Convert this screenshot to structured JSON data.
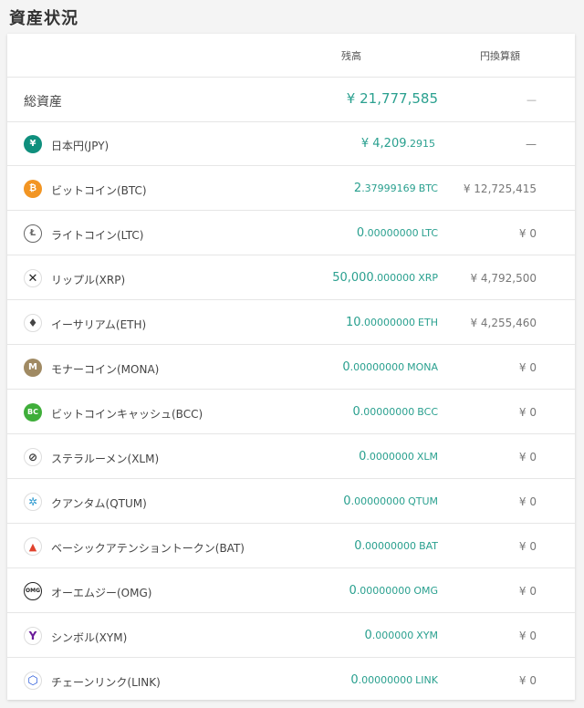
{
  "page_title": "資産状況",
  "table": {
    "headers": {
      "balance": "残高",
      "jpy": "円換算額"
    },
    "total": {
      "label": "総資産",
      "value": "¥ 21,777,585",
      "jpy": "—"
    },
    "rows": [
      {
        "name": "日本円(JPY)",
        "int": "¥ 4,209",
        "frac": ".2915",
        "unit": "",
        "jpy": "—",
        "icon": "yen-icon",
        "color": "#0f8f7d"
      },
      {
        "name": "ビットコイン(BTC)",
        "int": "2",
        "frac": ".37999169",
        "unit": "BTC",
        "jpy": "¥ 12,725,415",
        "icon": "bitcoin-icon",
        "color": "#f29523"
      },
      {
        "name": "ライトコイン(LTC)",
        "int": "0",
        "frac": ".00000000",
        "unit": "LTC",
        "jpy": "¥ 0",
        "icon": "litecoin-icon",
        "color": "#666666"
      },
      {
        "name": "リップル(XRP)",
        "int": "50,000",
        "frac": ".000000",
        "unit": "XRP",
        "jpy": "¥ 4,792,500",
        "icon": "ripple-icon",
        "color": "#222222"
      },
      {
        "name": "イーサリアム(ETH)",
        "int": "10",
        "frac": ".00000000",
        "unit": "ETH",
        "jpy": "¥ 4,255,460",
        "icon": "ethereum-icon",
        "color": "#444444"
      },
      {
        "name": "モナーコイン(MONA)",
        "int": "0",
        "frac": ".00000000",
        "unit": "MONA",
        "jpy": "¥ 0",
        "icon": "monacoin-icon",
        "color": "#a08a63"
      },
      {
        "name": "ビットコインキャッシュ(BCC)",
        "int": "0",
        "frac": ".00000000",
        "unit": "BCC",
        "jpy": "¥ 0",
        "icon": "bitcoin-cash-icon",
        "color": "#3fae3a"
      },
      {
        "name": "ステラルーメン(XLM)",
        "int": "0",
        "frac": ".0000000",
        "unit": "XLM",
        "jpy": "¥ 0",
        "icon": "stellar-icon",
        "color": "#333333"
      },
      {
        "name": "クアンタム(QTUM)",
        "int": "0",
        "frac": ".00000000",
        "unit": "QTUM",
        "jpy": "¥ 0",
        "icon": "qtum-icon",
        "color": "#2e9ad0"
      },
      {
        "name": "ベーシックアテンショントークン(BAT)",
        "int": "0",
        "frac": ".00000000",
        "unit": "BAT",
        "jpy": "¥ 0",
        "icon": "bat-icon",
        "color": "#e0432e"
      },
      {
        "name": "オーエムジー(OMG)",
        "int": "0",
        "frac": ".00000000",
        "unit": "OMG",
        "jpy": "¥ 0",
        "icon": "omg-icon",
        "color": "#222222"
      },
      {
        "name": "シンボル(XYM)",
        "int": "0",
        "frac": ".000000",
        "unit": "XYM",
        "jpy": "¥ 0",
        "icon": "symbol-icon",
        "color": "#6a1b9a"
      },
      {
        "name": "チェーンリンク(LINK)",
        "int": "0",
        "frac": ".00000000",
        "unit": "LINK",
        "jpy": "¥ 0",
        "icon": "chainlink-icon",
        "color": "#2a5ada"
      }
    ]
  }
}
